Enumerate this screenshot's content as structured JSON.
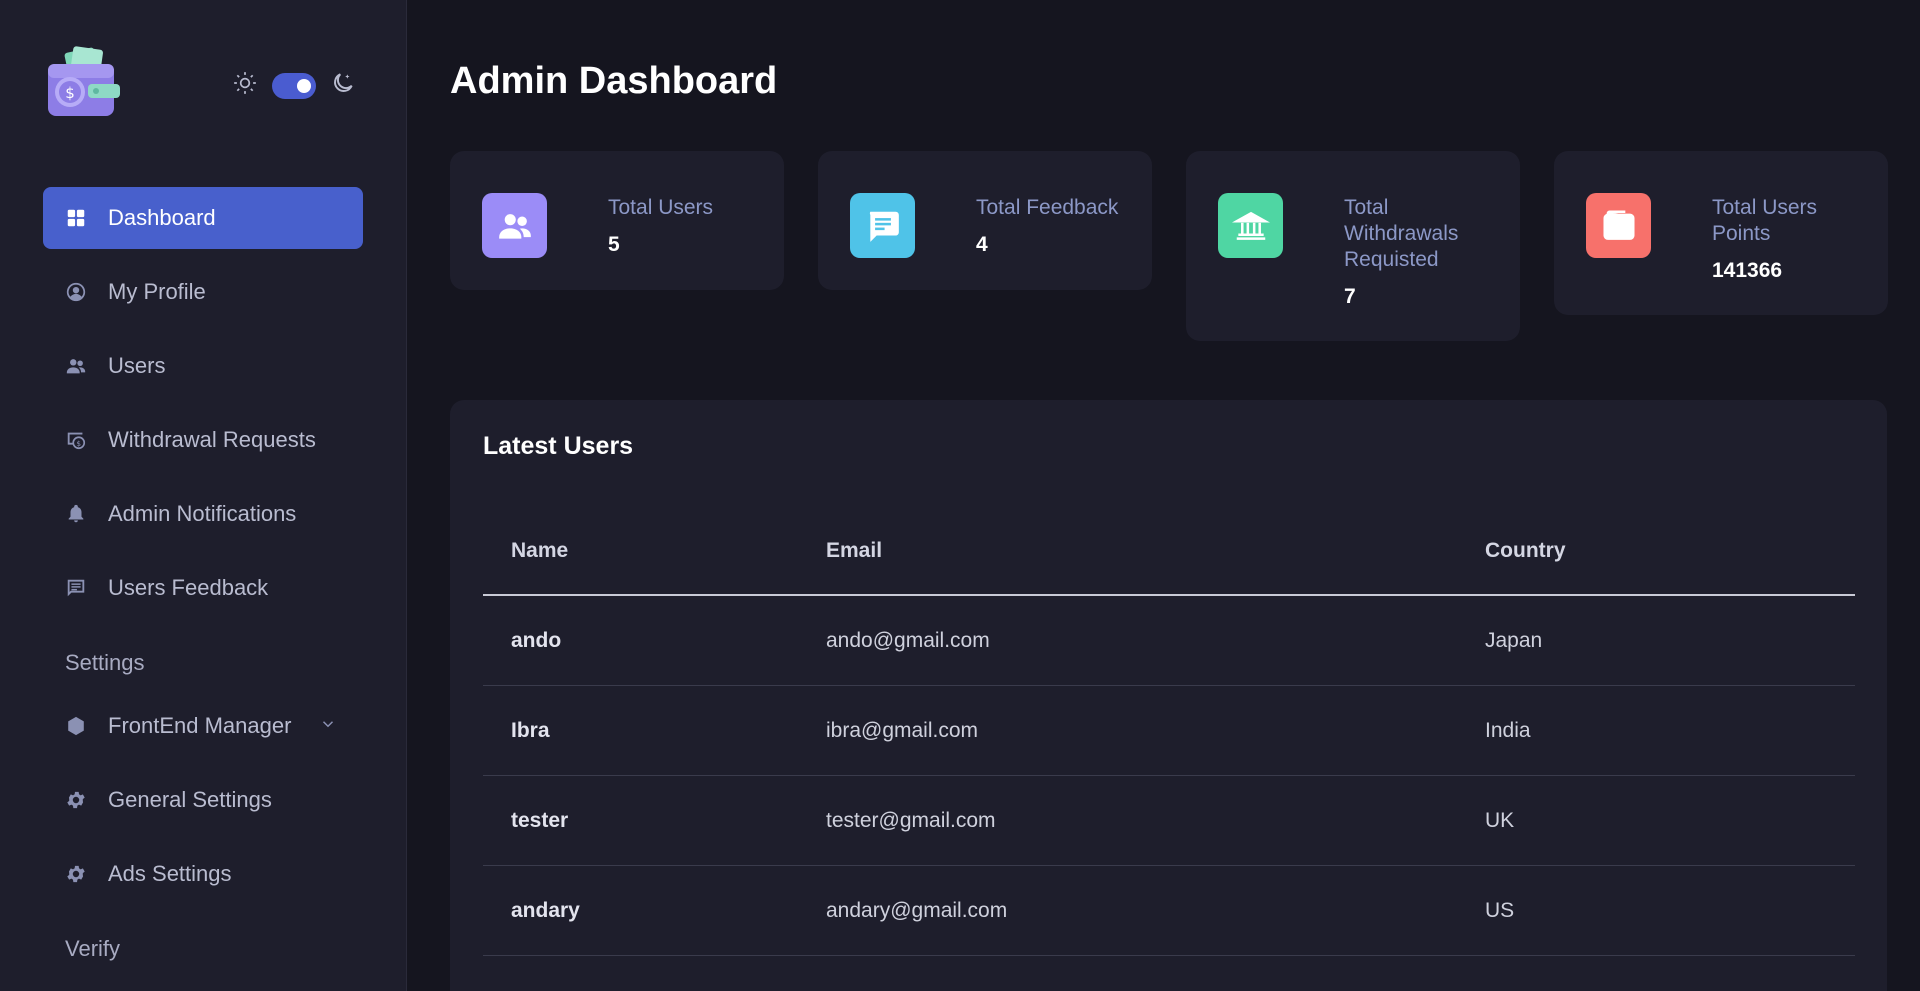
{
  "sidebar": {
    "items": [
      {
        "label": "Dashboard",
        "icon": "grid-icon",
        "active": true
      },
      {
        "label": "My Profile",
        "icon": "user-circle-icon"
      },
      {
        "label": "Users",
        "icon": "users-icon"
      },
      {
        "label": "Withdrawal Requests",
        "icon": "withdrawal-icon"
      },
      {
        "label": "Admin Notifications",
        "icon": "bell-icon"
      },
      {
        "label": "Users Feedback",
        "icon": "feedback-icon"
      }
    ],
    "settings_heading": "Settings",
    "settings_items": [
      {
        "label": "FrontEnd Manager",
        "icon": "hexagon-icon",
        "has_dropdown": true
      },
      {
        "label": "General Settings",
        "icon": "gear-icon"
      },
      {
        "label": "Ads Settings",
        "icon": "gear-icon"
      }
    ],
    "verify_heading": "Verify"
  },
  "theme_toggle": {
    "mode": "dark"
  },
  "header": {
    "title": "Admin Dashboard"
  },
  "cards": [
    {
      "label": "Total Users",
      "value": "5",
      "icon": "users-icon",
      "color": "#9b8cf7"
    },
    {
      "label": "Total Feedback",
      "value": "4",
      "icon": "chat-icon",
      "color": "#4fc3e8"
    },
    {
      "label": "Total Withdrawals Requisted",
      "value": "7",
      "icon": "bank-icon",
      "color": "#4fd6a3"
    },
    {
      "label": "Total Users Points",
      "value": "141366",
      "icon": "wallet-icon",
      "color": "#f7716b"
    }
  ],
  "latest_users": {
    "title": "Latest Users",
    "columns": [
      "Name",
      "Email",
      "Country"
    ],
    "rows": [
      {
        "name": "ando",
        "email": "ando@gmail.com",
        "country": "Japan"
      },
      {
        "name": "Ibra",
        "email": "ibra@gmail.com",
        "country": "India"
      },
      {
        "name": "tester",
        "email": "tester@gmail.com",
        "country": "UK"
      },
      {
        "name": "andary",
        "email": "andary@gmail.com",
        "country": "US"
      }
    ]
  },
  "colors": {
    "accent": "#4860cc",
    "background": "#15151f",
    "surface": "#1e1e2c"
  }
}
